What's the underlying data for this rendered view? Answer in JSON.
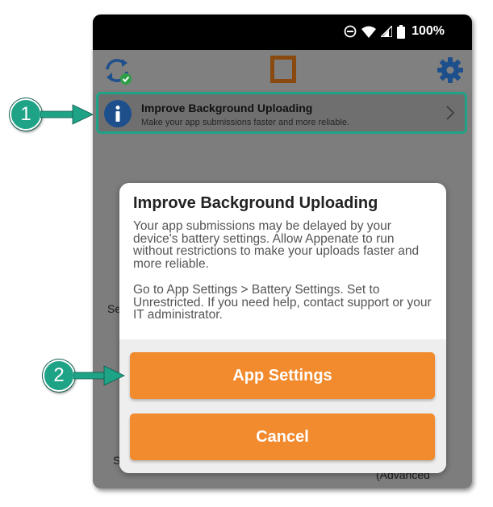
{
  "status_bar": {
    "battery": "100%"
  },
  "notice": {
    "title": "Improve Background Uploading",
    "subtitle": "Make your app submissions faster and more reliable."
  },
  "background_fragments": {
    "left_1": "Se",
    "left_2": "S",
    "right_1": "(Advanced"
  },
  "dialog": {
    "title": "Improve Background Uploading",
    "paragraph_1": "Your app submissions may be delayed by your device's battery settings. Allow Appenate to run without restrictions to make your uploads faster and more reliable.",
    "paragraph_2": "Go to App Settings > Battery Settings. Set to Unrestricted. If you need help, contact support or your IT administrator.",
    "primary_button": "App Settings",
    "secondary_button": "Cancel"
  },
  "callouts": {
    "one": "1",
    "two": "2"
  },
  "colors": {
    "accent_orange": "#f28a2e",
    "callout_teal": "#1fa387",
    "info_blue": "#1d4f8c"
  },
  "icons": {
    "header_left": "sync-check-icon",
    "header_center": "app-logo-icon",
    "header_right": "gear-icon",
    "notice_left": "info-icon",
    "notice_right": "chevron-right-icon"
  }
}
